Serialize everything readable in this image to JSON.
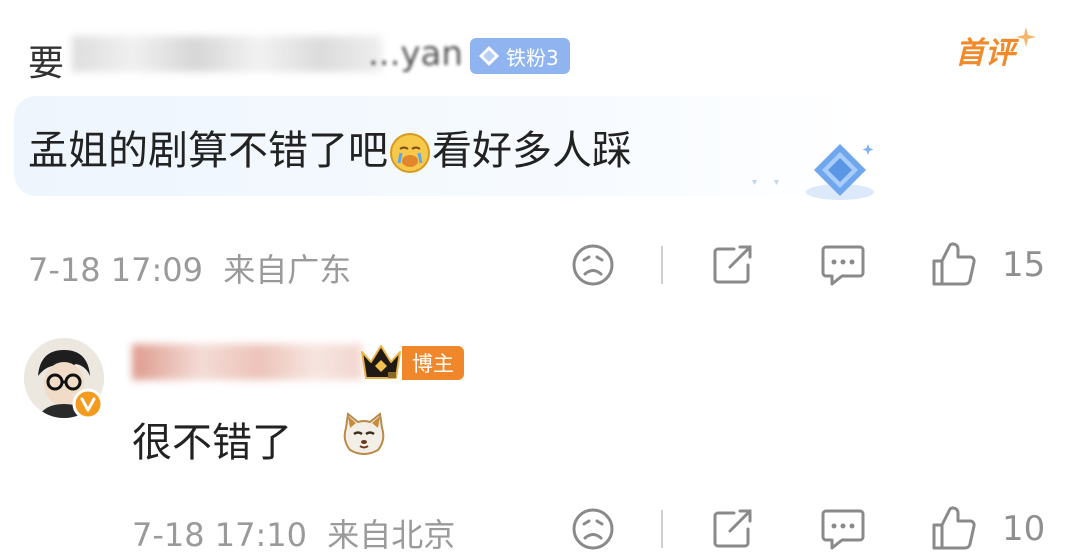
{
  "comment1": {
    "username_prefix": "要",
    "username_suffix": "...yan",
    "fan_badge": "铁粉3",
    "first_comment_tag": "首评",
    "text_before_emoji": "孟姐的剧算不错了吧",
    "emoji": "crying-emoji",
    "text_after_emoji": "看好多人踩",
    "timestamp": "7-18 17:09",
    "location": "来自广东",
    "like_count": "15"
  },
  "reply": {
    "username_prefix": "",
    "badge": "博主",
    "text": "很不错了",
    "emoji": "cat-emoji",
    "timestamp": "7-18 17:10",
    "location": "来自北京",
    "like_count": "10"
  },
  "colors": {
    "accent_orange": "#f0872a",
    "fan_badge_blue": "#8fb4f0",
    "meta_gray": "#9a9a9a"
  }
}
